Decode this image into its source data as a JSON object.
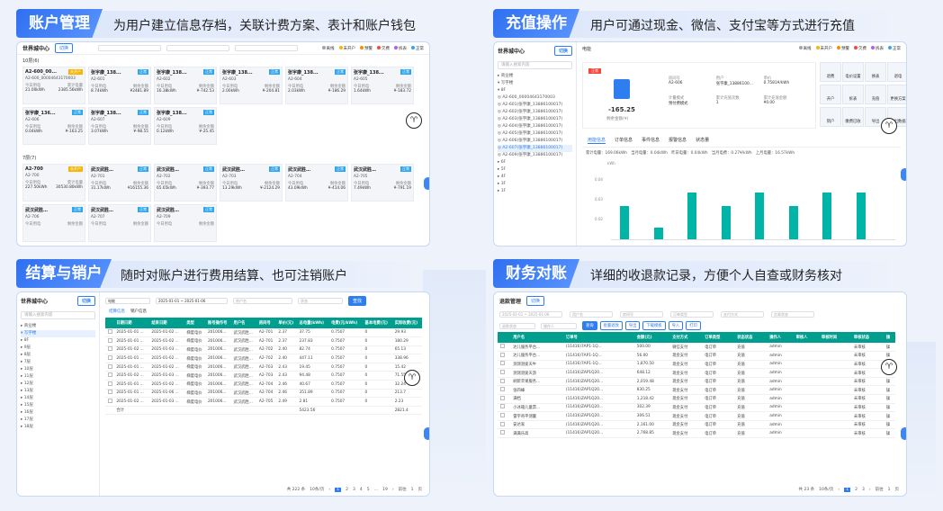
{
  "panels": [
    {
      "title": "账户管理",
      "subtitle": "为用户建立信息存档，关联计费方案、表计和账户钱包"
    },
    {
      "title": "充值操作",
      "subtitle": "用户可通过现金、微信、支付宝等方式进行充值"
    },
    {
      "title": "结算与销户",
      "subtitle": "随时对账户进行费用结算、也可注销账户"
    },
    {
      "title": "财务对账",
      "subtitle": "详细的收退款记录，方便个人自查或财务核对"
    }
  ],
  "p1": {
    "sidebar_title": "世界城中心",
    "btn": "切换",
    "legend": [
      "离线",
      "未开户",
      "预警",
      "欠费",
      "拆表",
      "正常"
    ],
    "group1": "10层(6)",
    "group2": "7层(7)",
    "cards1": [
      {
        "t": "A2-600_00...",
        "b": "未开户",
        "n": "A2-600_00004643170003",
        "c1": "今日用电",
        "c2": "累计电量",
        "v1": "21.00kWh",
        "v2": "2385.56kWh"
      },
      {
        "t": "张宇康_138...",
        "b": "正常",
        "n": "A2-601",
        "c1": "今日用电",
        "c2": "剩余金额",
        "v1": "8.74kWh",
        "v2": "¥2481.89"
      },
      {
        "t": "张宇康_138...",
        "b": "正常",
        "n": "A2-602",
        "c1": "今日用电",
        "c2": "剩余金额",
        "v1": "16.38kWh",
        "v2": "¥-742.53"
      },
      {
        "t": "张宇康_138...",
        "b": "正常",
        "n": "A2-603",
        "c1": "今日用电",
        "c2": "剩余金额",
        "v1": "2.00kWh",
        "v2": "¥-204.81"
      },
      {
        "t": "张宇康_138...",
        "b": "正常",
        "n": "A2-604",
        "c1": "今日用电",
        "c2": "剩余金额",
        "v1": "2.03kWh",
        "v2": "¥-186.29"
      },
      {
        "t": "张宇康_138...",
        "b": "正常",
        "n": "A2-605",
        "c1": "今日用电",
        "c2": "剩余金额",
        "v1": "1.64kWh",
        "v2": "¥-183.72"
      },
      {
        "t": "张宇康_136...",
        "b": "正常",
        "n": "A2-606",
        "c1": "今日用电",
        "c2": "剩余金额",
        "v1": "0.04kWh",
        "v2": "¥-163.25"
      },
      {
        "t": "张宇康_138...",
        "b": "正常",
        "n": "A2-607",
        "c1": "今日用电",
        "c2": "剩余金额",
        "v1": "3.07kWh",
        "v2": "¥-98.55"
      },
      {
        "t": "张宇康_138...",
        "b": "正常",
        "n": "A2-609",
        "c1": "今日用电",
        "c2": "剩余金额",
        "v1": "0.12kWh",
        "v2": "¥-25.45"
      }
    ],
    "cards2": [
      {
        "t": "A2-700",
        "b": "未开户",
        "n": "A2-700",
        "c1": "今日用电",
        "c2": "累计电量",
        "v1": "227.50kWh",
        "v2": "30530.80kWh"
      },
      {
        "t": "武汉武胜…",
        "b": "正常",
        "n": "A2-701",
        "c1": "今日用电",
        "c2": "剩余金额",
        "v1": "31.17kWh",
        "v2": "¥16155.36"
      },
      {
        "t": "武汉武胜…",
        "b": "正常",
        "n": "A2-702",
        "c1": "今日用电",
        "c2": "剩余金额",
        "v1": "65.65kWh",
        "v2": "¥-393.77"
      },
      {
        "t": "武汉武胜…",
        "b": "正常",
        "n": "A2-703",
        "c1": "今日用电",
        "c2": "剩余金额",
        "v1": "13.29kWh",
        "v2": "¥-2124.29"
      },
      {
        "t": "武汉武胜…",
        "b": "正常",
        "n": "A2-704",
        "c1": "今日用电",
        "c2": "剩余金额",
        "v1": "43.09kWh",
        "v2": "¥-414.06"
      },
      {
        "t": "武汉武胜…",
        "b": "正常",
        "n": "A2-705",
        "c1": "今日用电",
        "c2": "剩余金额",
        "v1": "7.49kWh",
        "v2": "¥-791.19"
      },
      {
        "t": "武汉武胜…",
        "b": "正常",
        "n": "A2-706",
        "c1": "今日用电",
        "c2": "剩余金额",
        "v1": "",
        "v2": ""
      },
      {
        "t": "武汉武胜…",
        "b": "正常",
        "n": "A2-707",
        "c1": "今日用电",
        "c2": "剩余金额",
        "v1": "",
        "v2": ""
      },
      {
        "t": "武汉武胜…",
        "b": "正常",
        "n": "A2-709",
        "c1": "今日用电",
        "c2": "剩余金额",
        "v1": "",
        "v2": ""
      }
    ]
  },
  "p2": {
    "sidebar_title": "世界城中心",
    "btn": "切换",
    "search": "请输入搜索内容",
    "tree": [
      "▸ 商业楼",
      "▾ 写字楼",
      "▾ 8F",
      "◎ A2-600_00004643170003",
      "◎ A2-601(张宇康_13886100017)",
      "◎ A2-602(张宇康_13886100017)",
      "◎ A2-603(张宇康_13886100017)",
      "◎ A2-604(张宇康_13886100017)",
      "◎ A2-605(张宇康_13886100017)",
      "◎ A2-606(张宇康_13886100017)",
      "◎ A2-607(张宇康_13886100017)",
      "◎ A2-609(张宇康_13886100017)",
      "▸ 6F",
      "▸ 5F",
      "▸ 4F",
      "▸ 3F",
      "▸ 1F"
    ],
    "legend": [
      "离线",
      "未开户",
      "预警",
      "欠费",
      "拆表",
      "正常"
    ],
    "label": "电能",
    "badge": "正常",
    "balance": "-165.25",
    "balance_lbl": "剩余金额(¥)",
    "info": [
      {
        "k": "房间号",
        "v": "A2-606"
      },
      {
        "k": "用户",
        "v": "张宇康_13886100..."
      },
      {
        "k": "单价",
        "v": "0.7581¥/kWh"
      },
      {
        "k": "计量模式",
        "v": "预付费模式"
      },
      {
        "k": "累计充值次数",
        "v": "1"
      },
      {
        "k": "累计充值金额",
        "v": "¥0.00"
      }
    ],
    "actions": [
      "退费",
      "电价设置",
      "换表",
      "退电",
      "开户",
      "拆表",
      "充值",
      "更换方案",
      "销户",
      "缴费已收",
      "导出",
      "导出数据"
    ],
    "tabs": [
      "用能信息",
      "订单信息",
      "事件信息",
      "报警信息",
      "状态量"
    ],
    "stats": "累计电量：169.06kWh　当月电量：0.04kWh　昨日电量：0.04kWh　当月电费：0.27¥/kWh　上月电量：16.57kWh",
    "chart_data": {
      "type": "bar",
      "ylabel": "kWh",
      "yticks": [
        "0.04",
        "0.03",
        "0.02"
      ],
      "values": [
        0.032,
        0.011,
        0.045,
        0.032,
        0.045,
        0.032,
        0.045,
        0.045
      ]
    }
  },
  "p3": {
    "sidebar_title": "世界城中心",
    "btn": "切换",
    "search": "请输入搜索内容",
    "tree": [
      "▸ 商业楼",
      "▾ 写字楼",
      "▸ 8F",
      "▸ 9层",
      "▸ 8层",
      "▸ 7层",
      "▸ 10层",
      "▸ 11层",
      "▸ 12层",
      "▸ 13层",
      "▸ 14层",
      "▸ 15层",
      "▸ 16层",
      "▸ 17层",
      "▸ 18层"
    ],
    "filter": "电能",
    "date": "2025-01-01 ~ 2025-01-06",
    "ph1": "房户名",
    "ph2": "状态",
    "search_btn": "查找",
    "subtabs": [
      "结算信息",
      "销户信息"
    ],
    "cols": [
      "",
      "日期日期",
      "结束日期",
      "类型",
      "账号操作号",
      "用户名",
      "房间号",
      "单价(元)",
      "总电量(kWh)",
      "电费(元/kWh)",
      "基本电费(元)",
      "实际收费(元)"
    ],
    "rows": [
      [
        "",
        "2025-01-01 ...",
        "2025-01-02 ...",
        "梯度电价",
        "201006...",
        "武汉武胜...",
        "A2-701",
        "2.37",
        "37.75",
        "0.7507",
        "0",
        "29.93"
      ],
      [
        "",
        "2025-01-01 ...",
        "2025-01-02 ...",
        "梯度电价",
        "201006...",
        "武汉武胜...",
        "A2-701",
        "2.37",
        "237.83",
        "0.7507",
        "0",
        "180.29"
      ],
      [
        "",
        "2025-01-02 ...",
        "2025-01-03 ...",
        "梯度电价",
        "201006...",
        "武汉武胜...",
        "A2-702",
        "2.40",
        "82.74",
        "0.7507",
        "0",
        "65.13"
      ],
      [
        "",
        "2025-01-01 ...",
        "2025-01-02 ...",
        "梯度电价",
        "201006...",
        "武汉武胜...",
        "A2-702",
        "2.40",
        "447.11",
        "0.7507",
        "0",
        "338.96"
      ],
      [
        "",
        "2025-01-01 ...",
        "2025-01-02 ...",
        "梯度电价",
        "201006...",
        "武汉武胜...",
        "A2-703",
        "2.43",
        "19.45",
        "0.7507",
        "0",
        "15.42"
      ],
      [
        "",
        "2025-01-02 ...",
        "2025-01-03 ...",
        "梯度电价",
        "201006...",
        "武汉武胜...",
        "A2-703",
        "2.43",
        "94.48",
        "0.7507",
        "0",
        "71.55"
      ],
      [
        "",
        "2025-01-01 ...",
        "2025-01-02 ...",
        "梯度电价",
        "201006...",
        "武汉武胜...",
        "A2-704",
        "2.46",
        "40.67",
        "0.7507",
        "0",
        "32.24"
      ],
      [
        "",
        "2025-01-01 ...",
        "2025-01-06 ...",
        "梯度电价",
        "201006...",
        "武汉武胜...",
        "A2-704",
        "2.46",
        "351.89",
        "0.7507",
        "0",
        "213.7"
      ],
      [
        "",
        "2025-01-02 ...",
        "2025-01-03 ...",
        "梯度电价",
        "201006...",
        "武汉武胜...",
        "A2-705",
        "2.49",
        "2.81",
        "0.7507",
        "0",
        "2.23"
      ]
    ],
    "total_lbl": "合计",
    "total_kwh": "5423.56",
    "total_fee": "2821.4",
    "pager": {
      "total": "共 222 条",
      "size": "10条/页",
      "pages": [
        "1",
        "2",
        "3",
        "4",
        "5",
        "…",
        "19"
      ],
      "goto": "前往",
      "page": "1",
      "suffix": "页"
    }
  },
  "p4": {
    "title": "退款管理",
    "btn": "切换",
    "filters": [
      "2025-01-01 ~ 2025-01-06",
      "用户名",
      "房间号",
      "订单类型",
      "支付方式",
      "交易状态"
    ],
    "filters2": [
      "退款状态",
      "操作人"
    ],
    "tools": [
      "查询",
      "批量退款",
      "导出",
      "下载模板",
      "导入",
      "打印"
    ],
    "cols": [
      "",
      "用户名",
      "订单号",
      "金额(元)",
      "支付方式",
      "订单类型",
      "状态状态",
      "操作人",
      "审核人",
      "审核时间",
      "审核状态",
      "操"
    ],
    "rows": [
      [
        "",
        "达儿服务平台...",
        "(11416)7AP1-1Q...",
        "500.00",
        "微信支付",
        "电订单",
        "充值",
        "admin",
        "",
        "",
        "未审核",
        "操"
      ],
      [
        "",
        "达儿服务平台...",
        "(11416)7AP1-1Q...",
        "56.00",
        "现金支付",
        "电订单",
        "充值",
        "admin",
        "",
        "",
        "未审核",
        "操"
      ],
      [
        "",
        "测测测爱天牛",
        "(11416)7AP1-1Q...",
        "1,870.50",
        "现金支付",
        "电订单",
        "充值",
        "admin",
        "",
        "",
        "未审核",
        "操"
      ],
      [
        "",
        "测测测爱天游",
        "(11416)ZAP1Q20...",
        "648.12",
        "现金支付",
        "电订单",
        "充值",
        "admin",
        "",
        "",
        "未审核",
        "操"
      ],
      [
        "",
        "刷新苹果服务...",
        "(11416)ZAP1Q20...",
        "2,019.48",
        "现金支付",
        "电订单",
        "充值",
        "admin",
        "",
        "",
        "未审核",
        "操"
      ],
      [
        "",
        "张四峰",
        "(11416)ZAP1Q20...",
        "830.25",
        "现金支付",
        "电订单",
        "充值",
        "admin",
        "",
        "",
        "未审核",
        "操"
      ],
      [
        "",
        "满档",
        "(11416)ZAP1Q20...",
        "1,218.42",
        "现金支付",
        "电订单",
        "充值",
        "admin",
        "",
        "",
        "未审核",
        "操"
      ],
      [
        "",
        "小冰箱儿童票...",
        "(11416)ZAP1Q20...",
        "302.39",
        "现金支付",
        "电订单",
        "充值",
        "admin",
        "",
        "",
        "未审核",
        "操"
      ],
      [
        "",
        "雷宇奇平测量",
        "(11416)ZAP1Q20...",
        "306.51",
        "现金支付",
        "电订单",
        "充值",
        "admin",
        "",
        "",
        "未审核",
        "操"
      ],
      [
        "",
        "安达家",
        "(11416)ZAP1Q20...",
        "2,161.00",
        "现金支付",
        "电订单",
        "充值",
        "admin",
        "",
        "",
        "未审核",
        "操"
      ],
      [
        "",
        "满满乐高",
        "(11416)ZAP1Q20...",
        "2,768.85",
        "现金支付",
        "电订单",
        "充值",
        "admin",
        "",
        "",
        "未审核",
        "操"
      ]
    ],
    "pager": {
      "total": "共 23 条",
      "size": "10条/页",
      "pages": [
        "1",
        "2",
        "3"
      ],
      "goto": "前往",
      "page": "1",
      "suffix": "页"
    }
  }
}
